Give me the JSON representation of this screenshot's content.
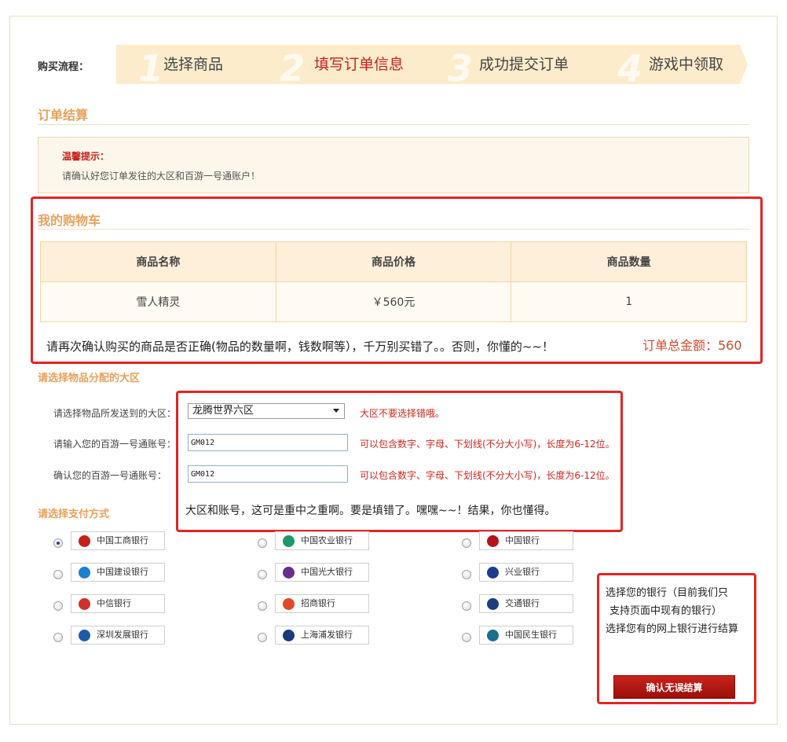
{
  "process": {
    "label": "购买流程：",
    "steps": [
      {
        "num": "1",
        "label": "选择商品"
      },
      {
        "num": "2",
        "label": "填写订单信息"
      },
      {
        "num": "3",
        "label": "成功提交订单"
      },
      {
        "num": "4",
        "label": "游戏中领取"
      }
    ]
  },
  "order_section_title": "订单结算",
  "tips": {
    "title": "温馨提示：",
    "text": "请确认好您订单发往的大区和百游一号通账户！"
  },
  "cart": {
    "title": "我的购物车",
    "headers": [
      "商品名称",
      "商品价格",
      "商品数量"
    ],
    "rows": [
      [
        "雪人精灵",
        "￥560元",
        "1"
      ]
    ],
    "note": "请再次确认购买的商品是否正确(物品的数量啊，钱数啊等），千万别买错了。。否则，你懂的~~！",
    "total": "订单总金额：560"
  },
  "region": {
    "title": "请选择物品分配的大区",
    "server_label": "请选择物品所发送到的大区：",
    "server_value": "龙腾世界六区",
    "server_hint": "大区不要选择错哦。",
    "account_label": "请输入您的百游一号通账号：",
    "account_value": "GM012",
    "account_hint": "可以包含数字、字母、下划线(不分大小写)，长度为6-12位。",
    "confirm_label": "确认您的百游一号通账号：",
    "confirm_value": "GM012",
    "confirm_hint": "可以包含数字、字母、下划线(不分大小写)，长度为6-12位。",
    "note": "大区和账号，这可是重中之重啊。要是填错了。嘿嘿~~！结果，你也懂得。"
  },
  "payment": {
    "title": "请选择支付方式",
    "banks": [
      {
        "name": "中国工商银行",
        "icon": "icbc-icon",
        "color": "#c4211d",
        "checked": true
      },
      {
        "name": "中国农业银行",
        "icon": "abc-icon",
        "color": "#1a9a6a",
        "checked": false
      },
      {
        "name": "中国银行",
        "icon": "boc-icon",
        "color": "#b5121b",
        "checked": false
      },
      {
        "name": "中国建设银行",
        "icon": "ccb-icon",
        "color": "#1d7fd0",
        "checked": false
      },
      {
        "name": "中国光大银行",
        "icon": "ceb-icon",
        "color": "#6b2c8f",
        "checked": false
      },
      {
        "name": "兴业银行",
        "icon": "cib-icon",
        "color": "#1c3c8f",
        "checked": false
      },
      {
        "name": "中信银行",
        "icon": "citic-icon",
        "color": "#d0312d",
        "checked": false
      },
      {
        "name": "招商银行",
        "icon": "cmb-icon",
        "color": "#e04826",
        "checked": false
      },
      {
        "name": "交通银行",
        "icon": "bocom-icon",
        "color": "#1b3f7a",
        "checked": false
      },
      {
        "name": "深圳发展银行",
        "icon": "sdb-icon",
        "color": "#1d5aa8",
        "checked": false
      },
      {
        "name": "上海浦发银行",
        "icon": "spdb-icon",
        "color": "#1b3a7a",
        "checked": false
      },
      {
        "name": "中国民生银行",
        "icon": "cmbc-icon",
        "color": "#1a6f8a",
        "checked": false
      }
    ],
    "bank_note_lines": [
      "选择您的银行（目前我们只",
      "支持页面中现有的银行）",
      "选择您有的网上银行进行结算"
    ],
    "confirm_button": "确认无误结算"
  },
  "colors": {
    "accent_orange": "#e8a15c",
    "step_bg": "#fdeccb",
    "alert_red": "#e32424",
    "button_red": "#b3160f"
  }
}
